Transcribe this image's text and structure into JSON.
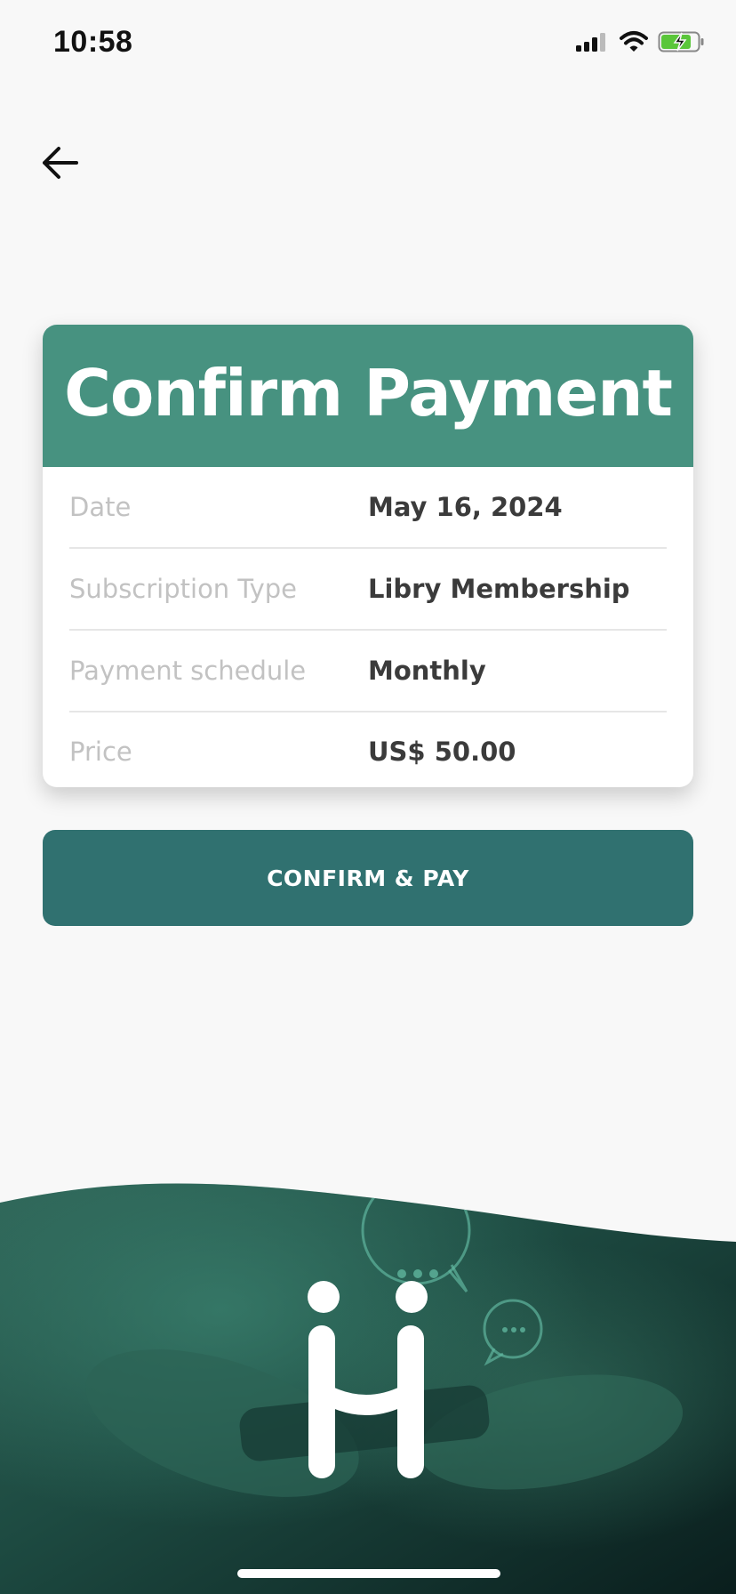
{
  "status_bar": {
    "time": "10:58",
    "icons": [
      "signal-icon",
      "wifi-icon",
      "battery-charging-icon"
    ]
  },
  "navigation": {
    "back_icon": "arrow-left-icon"
  },
  "card": {
    "title": "Confirm Payment",
    "rows": [
      {
        "label": "Date",
        "value": "May 16, 2024"
      },
      {
        "label": "Subscription Type",
        "value": "Libry Membership"
      },
      {
        "label": "Payment schedule",
        "value": "Monthly"
      },
      {
        "label": "Price",
        "value": "US$ 50.00"
      }
    ]
  },
  "actions": {
    "confirm_label": "CONFIRM & PAY"
  },
  "colors": {
    "header": "#479280",
    "button": "#307170",
    "background": "#f8f8f8"
  }
}
